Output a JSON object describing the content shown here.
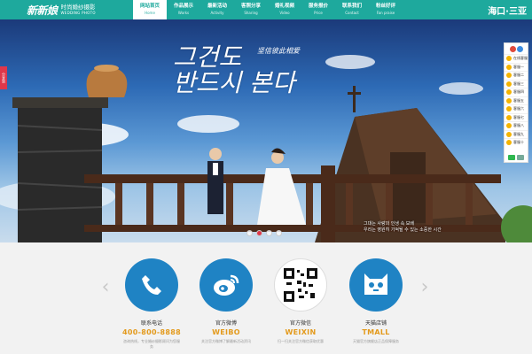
{
  "brand": {
    "logo_main": "新新娘",
    "logo_cn": "时尚婚纱摄影",
    "logo_en": "WEDDING PHOTO"
  },
  "nav": [
    {
      "cn": "网站首页",
      "en": "Home",
      "active": true
    },
    {
      "cn": "作品展示",
      "en": "Works"
    },
    {
      "cn": "最新活动",
      "en": "Activity"
    },
    {
      "cn": "客照分享",
      "en": "Sharing"
    },
    {
      "cn": "婚礼视频",
      "en": "Video"
    },
    {
      "cn": "服务报价",
      "en": "Price"
    },
    {
      "cn": "联系我们",
      "en": "Contact"
    },
    {
      "cn": "粉丝好评",
      "en": "Fan praise"
    }
  ],
  "region": "海口·三亚",
  "banner": {
    "korean_title_line1": "그건도",
    "korean_title_line2": "반드시 본다",
    "cn_title": "坚信彼此相爱",
    "caption_line1": "그대는 사랑의 인생 속 보배",
    "caption_line2": "우리는 영원히 기억될 수 있는 소중한 시간",
    "dots": 4,
    "active_dot": 2
  },
  "side_tab": "分享到",
  "widget": {
    "items": [
      "在线客服",
      "客服一",
      "客服二",
      "客服三",
      "客服四",
      "客服五",
      "客服六",
      "客服七",
      "客服八",
      "客服九",
      "客服十"
    ]
  },
  "contact": {
    "cards": [
      {
        "title": "联系电话",
        "value": "400-800-8888",
        "icon": "phone-icon",
        "desc": "咨询热线，专业婚纱摄影顾问为您服务"
      },
      {
        "title": "官方微博",
        "value": "WEIBO",
        "icon": "weibo-icon",
        "desc": "关注官方微博了解最新活动资讯"
      },
      {
        "title": "官方微信",
        "value": "WEIXIN",
        "icon": "qrcode-icon",
        "desc": "扫一扫关注官方微信获取优惠"
      },
      {
        "title": "天猫店铺",
        "value": "TMALL",
        "icon": "tmall-icon",
        "desc": "天猫官方旗舰店正品保障服务"
      }
    ]
  },
  "colors": {
    "header": "#1ea99d",
    "accent_orange": "#e39a1c",
    "icon_blue": "#1f83c4",
    "active_dot": "#e0374a"
  }
}
